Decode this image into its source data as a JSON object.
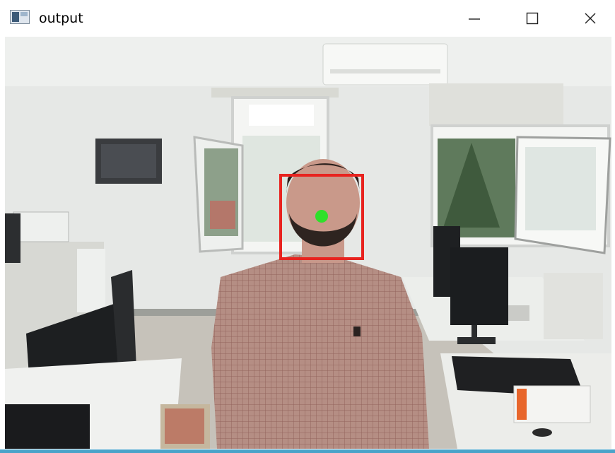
{
  "window": {
    "title": "output",
    "app_icon": "window-icon",
    "controls": {
      "minimize": "minimize-icon",
      "maximize": "maximize-icon",
      "close": "close-icon"
    },
    "accent_color": "#4aa3c9"
  },
  "frame": {
    "content": "webcam-frame",
    "face_box_color": "#e8231f",
    "face_point_color": "#2fe02a"
  }
}
